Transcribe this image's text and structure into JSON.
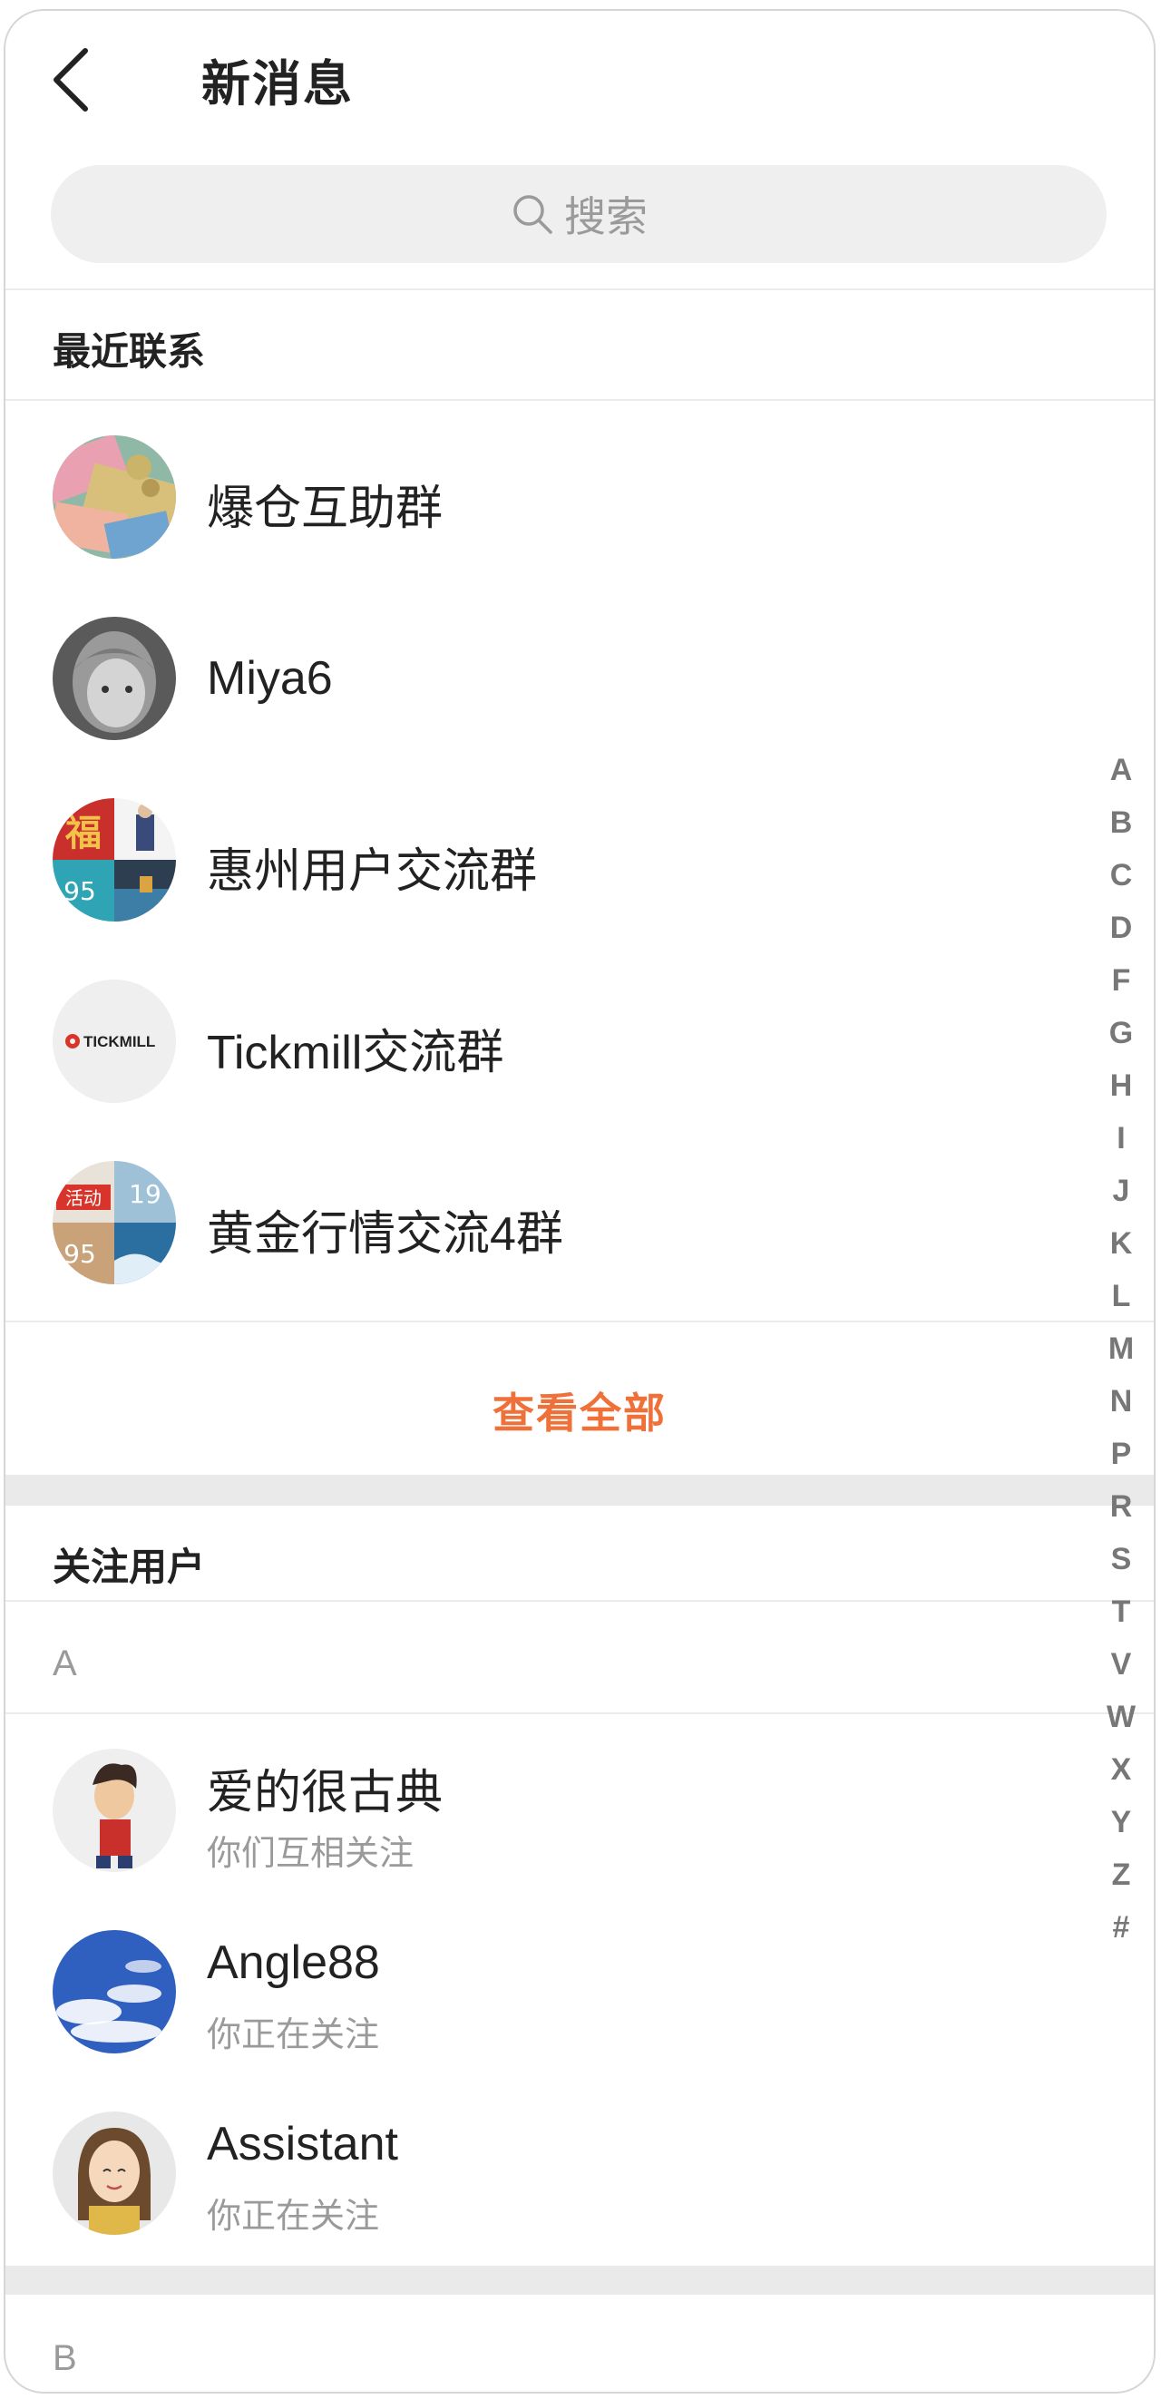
{
  "header": {
    "title": "新消息"
  },
  "search": {
    "placeholder": "搜索"
  },
  "recent": {
    "title": "最近联系",
    "items": [
      {
        "name": "爆仓互助群",
        "avatar": "money-collage-avatar"
      },
      {
        "name": "Miya6",
        "avatar": "child-photo-avatar"
      },
      {
        "name": "惠州用户交流群",
        "avatar": "group-collage-avatar",
        "avatar_text": [
          "福",
          "95"
        ]
      },
      {
        "name": "Tickmill交流群",
        "avatar": "tickmill-logo-avatar",
        "avatar_text": [
          "TICKMILL"
        ]
      },
      {
        "name": "黄金行情交流4群",
        "avatar": "group-collage-avatar",
        "avatar_text": [
          "活动",
          "19",
          "95"
        ]
      }
    ],
    "view_all": "查看全部"
  },
  "following": {
    "title": "关注用户",
    "groups": [
      {
        "letter": "A",
        "items": [
          {
            "name": "爱的很古典",
            "status": "你们互相关注",
            "avatar": "cartoon-man-avatar"
          },
          {
            "name": "Angle88",
            "status": "你正在关注",
            "avatar": "sky-clouds-avatar"
          },
          {
            "name": "Assistant",
            "status": "你正在关注",
            "avatar": "cartoon-woman-avatar"
          }
        ]
      },
      {
        "letter": "B",
        "items": []
      }
    ]
  },
  "alphabet_index": [
    "A",
    "B",
    "C",
    "D",
    "F",
    "G",
    "H",
    "I",
    "J",
    "K",
    "L",
    "M",
    "N",
    "P",
    "R",
    "S",
    "T",
    "V",
    "W",
    "X",
    "Y",
    "Z",
    "#"
  ],
  "colors": {
    "accent": "#f0703a",
    "search_bg": "#efefef",
    "band": "#eaeaea",
    "secondary_text": "#9a9a9a"
  }
}
